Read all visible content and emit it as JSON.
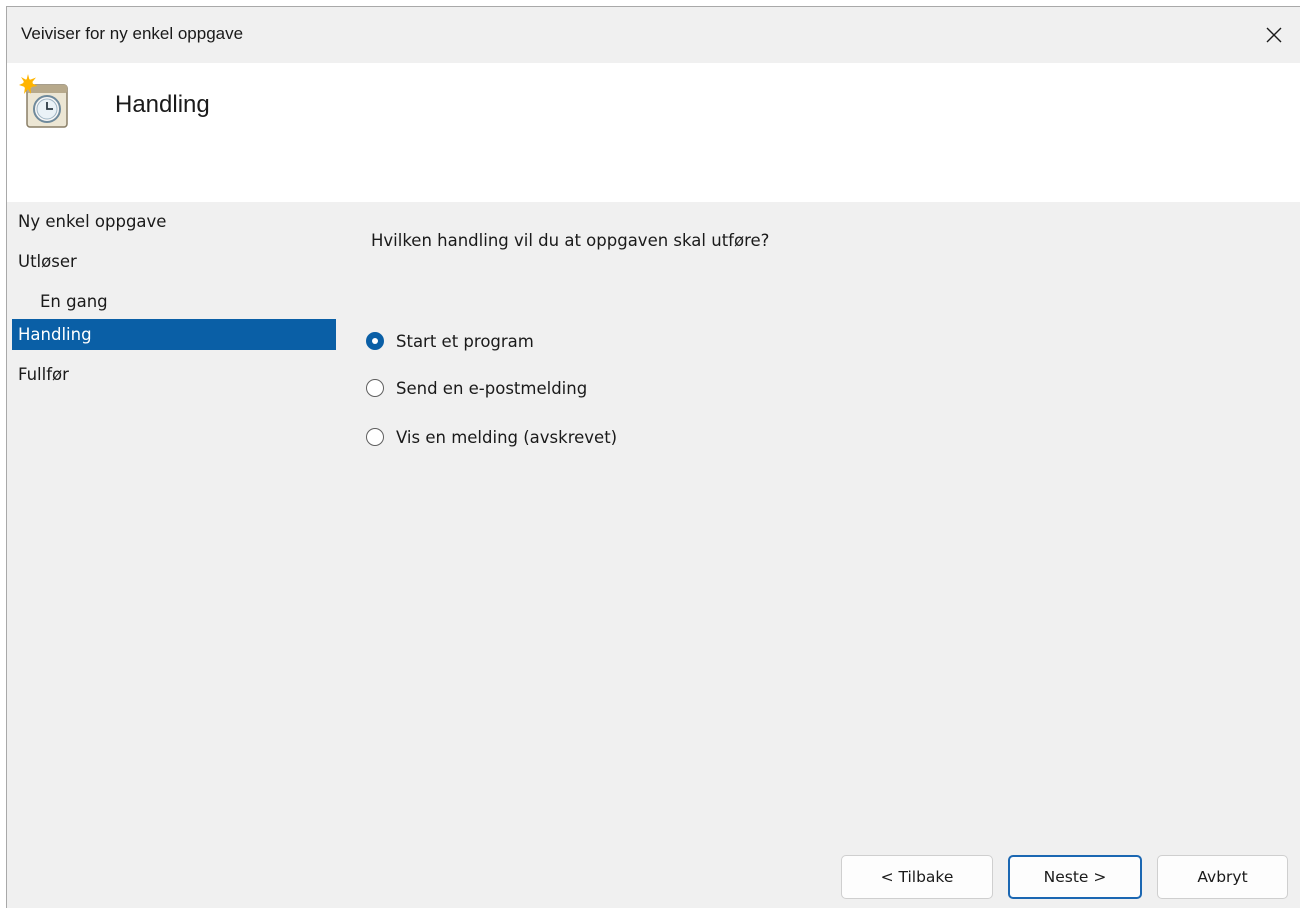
{
  "window": {
    "title": "Veiviser for ny enkel oppgave",
    "close_icon": "close-icon"
  },
  "header": {
    "icon": "task-scheduler-clock-icon",
    "title": "Handling"
  },
  "steps": [
    {
      "label": "Ny enkel oppgave",
      "active": false,
      "sub": false
    },
    {
      "label": "Utløser",
      "active": false,
      "sub": false
    },
    {
      "label": "En gang",
      "active": false,
      "sub": true
    },
    {
      "label": "Handling",
      "active": true,
      "sub": false
    },
    {
      "label": "Fullfør",
      "active": false,
      "sub": false
    }
  ],
  "main": {
    "question": "Hvilken handling vil du at oppgaven skal utføre?",
    "options": [
      {
        "label": "Start et program",
        "checked": true
      },
      {
        "label": "Send en e-postmelding",
        "checked": false
      },
      {
        "label": "Vis en melding (avskrevet)",
        "checked": false
      }
    ]
  },
  "buttons": {
    "back": "< Tilbake",
    "next": "Neste >",
    "cancel": "Avbryt"
  },
  "colors": {
    "accent": "#0a5fa6",
    "window_bg": "#f0f0f0",
    "header_bg": "#ffffff"
  }
}
